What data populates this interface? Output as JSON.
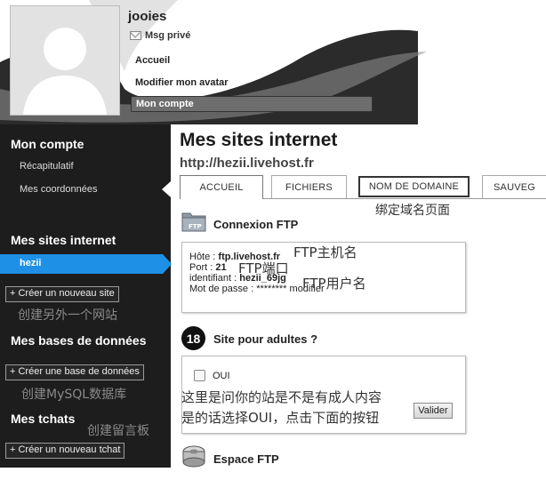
{
  "header": {
    "username": "jooies",
    "msg_label": "Msg privé",
    "nav": {
      "accueil": "Accueil",
      "avatar": "Modifier mon avatar",
      "compte": "Mon compte"
    }
  },
  "sidebar": {
    "section_account": "Mon compte",
    "item_recap": "Récapitulatif",
    "item_coords": "Mes coordonnées",
    "section_sites": "Mes sites internet",
    "active_site": "hezii",
    "btn_new_site": "+ Créer un nouveau site",
    "note_new_site": "创建另外一个网站",
    "section_db": "Mes bases de données",
    "btn_new_db": "+ Créer une base de données",
    "note_new_db": "创建MySQL数据库",
    "section_chats": "Mes tchats",
    "note_chats": "创建留言板",
    "btn_new_chat": "+ Créer un nouveau tchat"
  },
  "main": {
    "title": "Mes sites internet",
    "url": "http://hezii.livehost.fr",
    "tabs": {
      "accueil": "ACCUEIL",
      "fichiers": "FICHIERS",
      "domaine": "NOM DE DOMAINE",
      "sauveg": "SAUVEG"
    },
    "note_domain": "绑定域名页面",
    "ftp": {
      "title": "Connexion FTP",
      "icon_label": "FTP",
      "host_label": "Hôte : ",
      "host_value": "ftp.livehost.fr",
      "port_label": "Port : ",
      "port_value": "21",
      "id_label": "identifiant : ",
      "id_value": "hezii_69jg",
      "pwd_label": "Mot de passe : ",
      "pwd_value": "********",
      "pwd_link": "modifier",
      "note_host": "FTP主机名",
      "note_port": "FTP端口",
      "note_user": "FTP用户名"
    },
    "adult": {
      "badge": "18",
      "title": "Site pour adultes ?",
      "option_label": "OUI",
      "submit": "Valider",
      "note_line1": "这里是问你的站是不是有成人内容",
      "note_line2": "是的话选择OUI，点击下面的按钮"
    },
    "space": {
      "title": "Espace FTP"
    }
  },
  "colors": {
    "sidebar_bg": "#1d1d1d",
    "active_item": "#1e90e6",
    "account_button": "#6e6e6e"
  }
}
